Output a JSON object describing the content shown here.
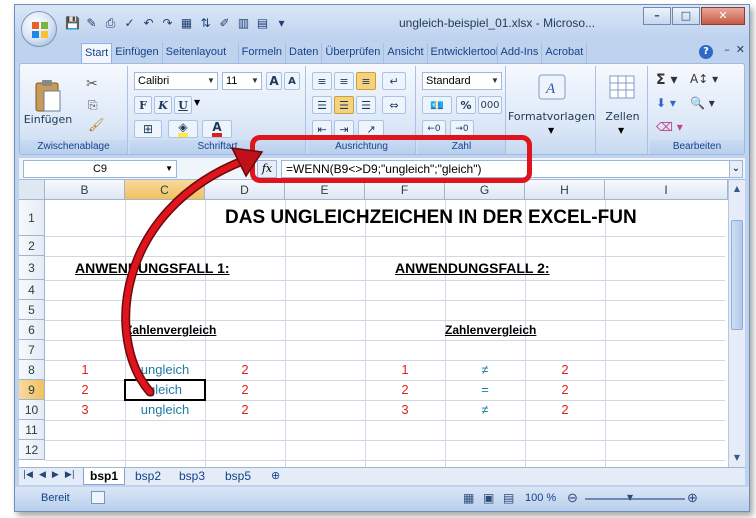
{
  "window": {
    "title": "ungleich-beispiel_01.xlsx - Microso...",
    "controls": {
      "minimize": "–",
      "maximize": "□",
      "close": "✕"
    }
  },
  "ribbon_tabs": [
    "Start",
    "Einfügen",
    "Seitenlayout",
    "Formeln",
    "Daten",
    "Überprüfen",
    "Ansicht",
    "Entwicklertools",
    "Add-Ins",
    "Acrobat"
  ],
  "ribbon": {
    "clipboard": {
      "label": "Zwischenablage",
      "paste": "Einfügen"
    },
    "font": {
      "label": "Schriftart",
      "name": "Calibri",
      "size": "11",
      "bold": "F",
      "italic": "K",
      "underline": "U",
      "grow": "A",
      "shrink": "A"
    },
    "alignment": {
      "label": "Ausrichtung"
    },
    "number": {
      "label": "Zahl",
      "format": "Standard",
      "percent": "%",
      "thousands": "000"
    },
    "styles": {
      "label": "Formatvorlagen"
    },
    "cells": {
      "label": "Zellen"
    },
    "editing": {
      "label": "Bearbeiten"
    }
  },
  "formula_bar": {
    "name_box": "C9",
    "fx": "fx",
    "formula": "=WENN(B9<>D9;\"ungleich\";\"gleich\")"
  },
  "columns": [
    "B",
    "C",
    "D",
    "E",
    "F",
    "G",
    "H",
    "I"
  ],
  "rows": [
    "1",
    "2",
    "3",
    "4",
    "5",
    "6",
    "7",
    "8",
    "9",
    "10",
    "11",
    "12"
  ],
  "cells": {
    "title": "DAS UNGLEICHZEICHEN IN DER EXCEL-FUN",
    "case1": "ANWENDUNGSFALL 1:",
    "case2": "ANWENDUNGSFALL 2:",
    "sub1": "Zahlenvergleich",
    "sub2": "Zahlenvergleich",
    "table1": [
      {
        "b": "1",
        "c": "ungleich",
        "d": "2"
      },
      {
        "b": "2",
        "c": "gleich",
        "d": "2"
      },
      {
        "b": "3",
        "c": "ungleich",
        "d": "2"
      }
    ],
    "table2": [
      {
        "f": "1",
        "g": "≠",
        "h": "2"
      },
      {
        "f": "2",
        "g": "=",
        "h": "2"
      },
      {
        "f": "3",
        "g": "≠",
        "h": "2"
      }
    ]
  },
  "sheets": [
    "bsp1",
    "bsp2",
    "bsp3",
    "bsp5"
  ],
  "status": {
    "mode": "Bereit",
    "zoom": "100 %"
  }
}
